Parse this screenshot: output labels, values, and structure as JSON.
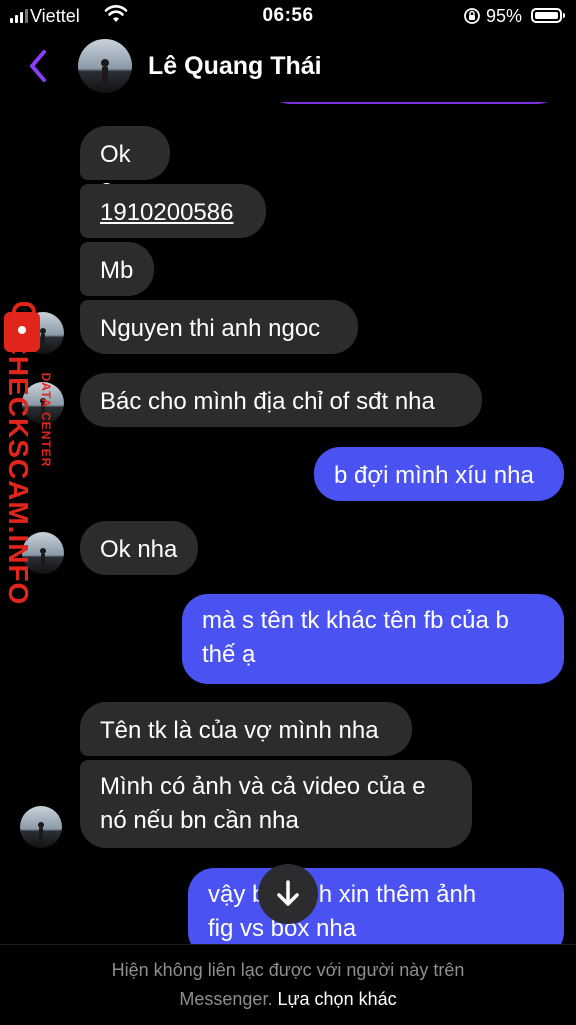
{
  "status_bar": {
    "carrier": "Viettel",
    "time": "06:56",
    "battery": "95%"
  },
  "header": {
    "contact_name": "Lê Quang Thái"
  },
  "messages": [
    {
      "direction": "incoming",
      "text": "Ok ạ"
    },
    {
      "direction": "incoming",
      "text": "1910200586"
    },
    {
      "direction": "incoming",
      "text": "Mb"
    },
    {
      "direction": "incoming",
      "text": "Nguyen thi anh ngoc"
    },
    {
      "direction": "incoming",
      "text": "Bác cho mình địa chỉ of sđt nha"
    },
    {
      "direction": "outgoing",
      "text": "b đợi mình xíu nha"
    },
    {
      "direction": "incoming",
      "text": "Ok nha"
    },
    {
      "direction": "outgoing",
      "lines": [
        "mà s tên tk khác tên fb của b",
        "thế ạ"
      ]
    },
    {
      "direction": "incoming",
      "text": "Tên tk là của vợ mình nha"
    },
    {
      "direction": "incoming",
      "lines": [
        "Mình có ảnh và cả video của e",
        "nó nếu bn cần nha"
      ]
    },
    {
      "direction": "outgoing",
      "lines": [
        "vậy b  mình xin thêm ảnh",
        "fig vs box nha"
      ]
    }
  ],
  "watermark": {
    "brand": "CHECKSCAM.INFO",
    "subtitle": "DATA CENTER"
  },
  "footer": {
    "notice": "Hiện không liên lạc được với người này trên",
    "notice_line2": "Messenger.",
    "link": "Lựa chọn khác"
  },
  "colors": {
    "incoming_bubble": "#2c2c2e",
    "outgoing_bubble": "#4a52f2",
    "accent": "#7a2fe0",
    "back_arrow": "#8b3dff"
  },
  "icons": {
    "back": "chevron-left-icon",
    "wifi": "wifi-icon",
    "rotation_lock": "rotation-lock-icon",
    "battery": "battery-icon",
    "scroll_down": "arrow-down-icon"
  }
}
